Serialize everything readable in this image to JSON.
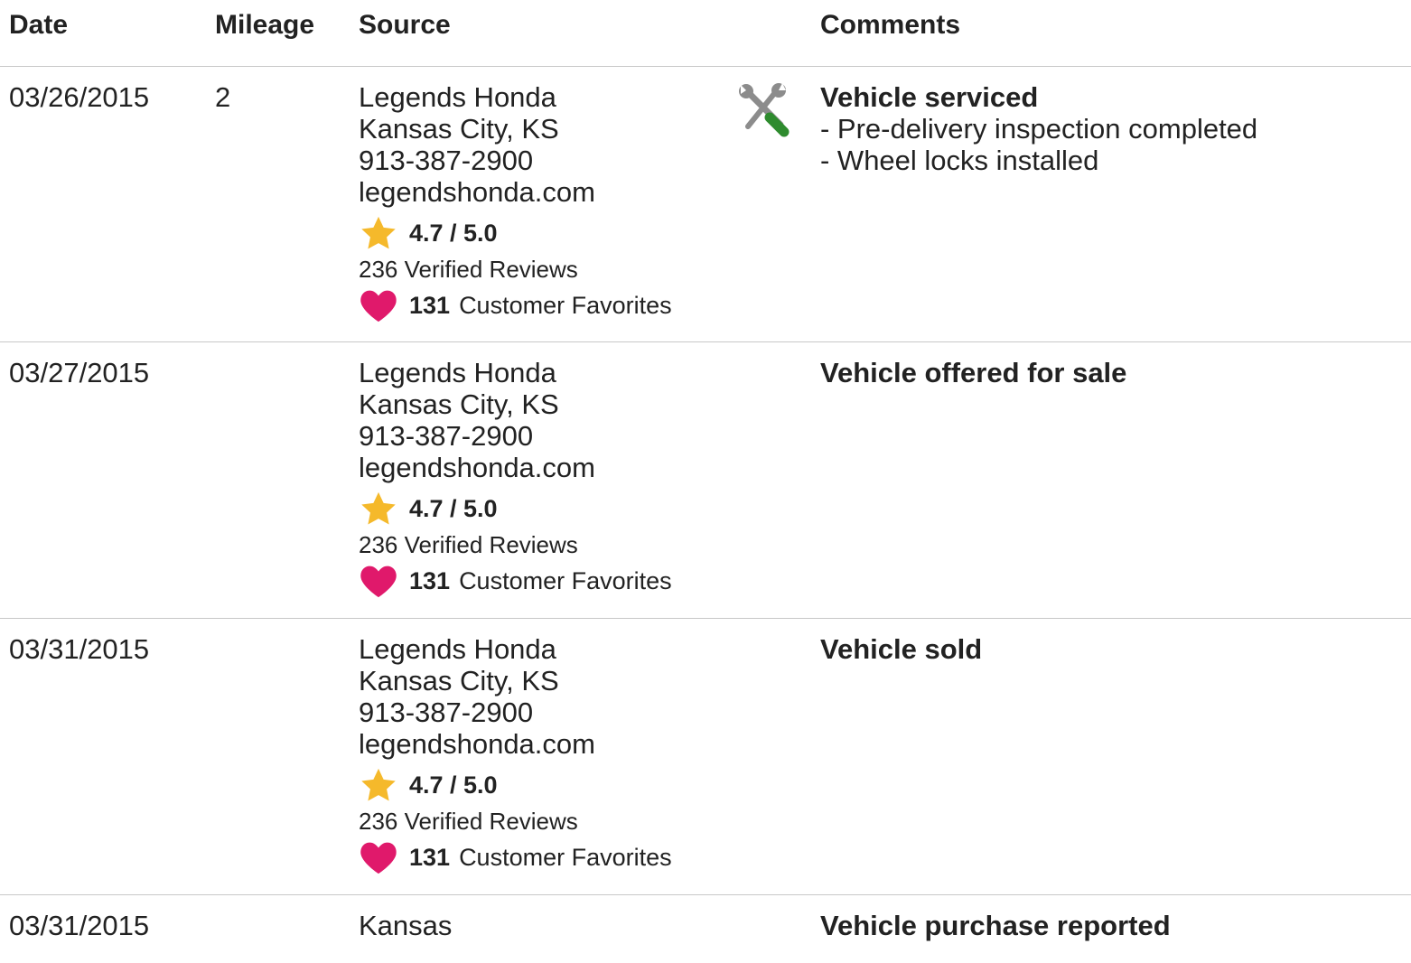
{
  "headers": {
    "date": "Date",
    "mileage": "Mileage",
    "source": "Source",
    "comments": "Comments"
  },
  "colors": {
    "star": "#F5B92B",
    "heart": "#E0196B",
    "wrench": "#8C8C8C",
    "screwdriver": "#2E8B2E",
    "divider": "#C8C8C8"
  },
  "rows": [
    {
      "date": "03/26/2015",
      "mileage": "2",
      "source": {
        "name": "Legends Honda",
        "location": "Kansas City, KS",
        "phone": "913-387-2900",
        "website": "legendshonda.com",
        "rating": "4.7 / 5.0",
        "reviews": "236 Verified Reviews",
        "favorites_count": "131",
        "favorites_label": "Customer Favorites"
      },
      "icon": "service-tools-icon",
      "comment_title": "Vehicle serviced",
      "comment_details": [
        "- Pre-delivery inspection completed",
        "- Wheel locks installed"
      ]
    },
    {
      "date": "03/27/2015",
      "mileage": "",
      "source": {
        "name": "Legends Honda",
        "location": "Kansas City, KS",
        "phone": "913-387-2900",
        "website": "legendshonda.com",
        "rating": "4.7 / 5.0",
        "reviews": "236 Verified Reviews",
        "favorites_count": "131",
        "favorites_label": "Customer Favorites"
      },
      "comment_title": "Vehicle offered for sale"
    },
    {
      "date": "03/31/2015",
      "mileage": "",
      "source": {
        "name": "Legends Honda",
        "location": "Kansas City, KS",
        "phone": "913-387-2900",
        "website": "legendshonda.com",
        "rating": "4.7 / 5.0",
        "reviews": "236 Verified Reviews",
        "favorites_count": "131",
        "favorites_label": "Customer Favorites"
      },
      "comment_title": "Vehicle sold"
    },
    {
      "date": "03/31/2015",
      "mileage": "",
      "source": {
        "name": "Kansas"
      },
      "comment_title": "Vehicle purchase reported"
    }
  ]
}
